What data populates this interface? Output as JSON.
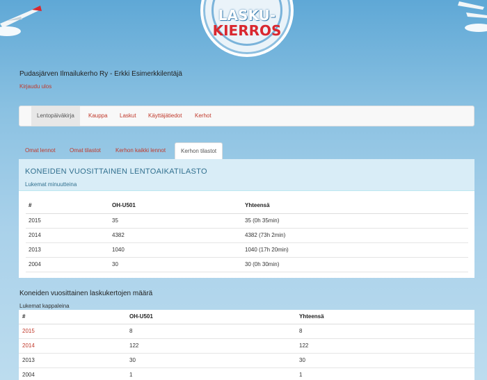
{
  "logo": {
    "line1": "LASKU-",
    "line2": "KIERROS"
  },
  "header": {
    "user_line": "Pudasjärven Ilmailukerho Ry - Erkki Esimerkkilentäjä",
    "logout_label": "Kirjaudu ulos"
  },
  "main_nav": {
    "items": [
      {
        "label": "Lentopäiväkirja",
        "active": true
      },
      {
        "label": "Kauppa"
      },
      {
        "label": "Laskut"
      },
      {
        "label": "Käyttäjätiedot"
      },
      {
        "label": "Kerhot"
      }
    ]
  },
  "sub_tabs": {
    "items": [
      {
        "label": "Omat lennot"
      },
      {
        "label": "Omat tilastot"
      },
      {
        "label": "Kerhon kaikki lennot"
      },
      {
        "label": "Kerhon tilastot",
        "active": true
      }
    ]
  },
  "flight_time_stats": {
    "title": "KONEIDEN VUOSITTAINEN LENTOAIKATILASTO",
    "subtitle": "Lukemat minuutteina",
    "columns": [
      "#",
      "OH-U501",
      "Yhteensä"
    ],
    "rows": [
      [
        "2015",
        "35",
        "35 (0h 35min)"
      ],
      [
        "2014",
        "4382",
        "4382 (73h 2min)"
      ],
      [
        "2013",
        "1040",
        "1040 (17h 20min)"
      ],
      [
        "2004",
        "30",
        "30 (0h 30min)"
      ]
    ]
  },
  "landing_stats": {
    "title": "Koneiden vuosittainen laskukertojen määrä",
    "subtitle": "Lukemat kappaleina",
    "columns": [
      "#",
      "OH-U501",
      "Yhteensä"
    ],
    "rows": [
      [
        "2015",
        "8",
        "8"
      ],
      [
        "2014",
        "122",
        "122"
      ],
      [
        "2013",
        "30",
        "30"
      ],
      [
        "2004",
        "1",
        "1"
      ]
    ]
  },
  "colors": {
    "link": "#c0392b",
    "panel_head": "#d9edf7",
    "panel_title": "#31708f"
  }
}
